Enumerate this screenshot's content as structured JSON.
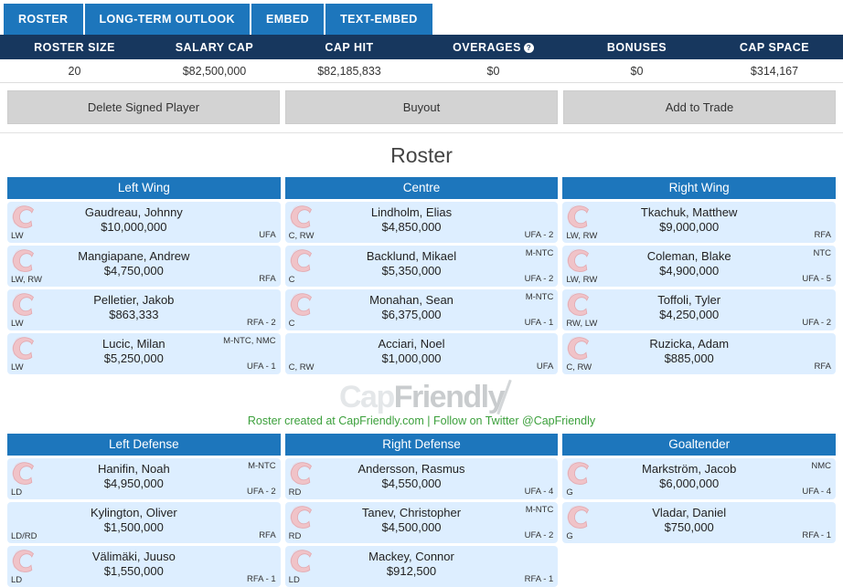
{
  "tabs": [
    {
      "label": "ROSTER",
      "active": true
    },
    {
      "label": "LONG-TERM OUTLOOK",
      "active": false
    },
    {
      "label": "EMBED",
      "active": false
    },
    {
      "label": "TEXT-EMBED",
      "active": false
    }
  ],
  "summary": {
    "headers": [
      "ROSTER SIZE",
      "SALARY CAP",
      "CAP HIT",
      "OVERAGES",
      "BONUSES",
      "CAP SPACE"
    ],
    "values": [
      "20",
      "$82,500,000",
      "$82,185,833",
      "$0",
      "$0",
      "$314,167"
    ],
    "overages_help_glyph": "?"
  },
  "actions": [
    {
      "label": "Delete Signed Player"
    },
    {
      "label": "Buyout"
    },
    {
      "label": "Add to Trade"
    }
  ],
  "roster_title": "Roster",
  "watermark": {
    "part1": "Cap",
    "part2": "Friendly"
  },
  "attribution": "Roster created at CapFriendly.com | Follow on Twitter @CapFriendly",
  "colors": {
    "tab_blue": "#1d76bc",
    "header_navy": "#17375e",
    "row_blue": "#ddeeff",
    "button_gray": "#d3d3d3",
    "attribution_green": "#3ca03c",
    "logo_pink": "#eebfc4"
  },
  "forwards": [
    {
      "heading": "Left Wing",
      "players": [
        {
          "name": "Gaudreau, Johnny",
          "salary": "$10,000,000",
          "pos": "LW",
          "clause": "",
          "expiry": "UFA",
          "logo": true
        },
        {
          "name": "Mangiapane, Andrew",
          "salary": "$4,750,000",
          "pos": "LW, RW",
          "clause": "",
          "expiry": "RFA",
          "logo": true
        },
        {
          "name": "Pelletier, Jakob",
          "salary": "$863,333",
          "pos": "LW",
          "clause": "",
          "expiry": "RFA - 2",
          "logo": true
        },
        {
          "name": "Lucic, Milan",
          "salary": "$5,250,000",
          "pos": "LW",
          "clause": "M-NTC, NMC",
          "expiry": "UFA - 1",
          "logo": true
        }
      ]
    },
    {
      "heading": "Centre",
      "players": [
        {
          "name": "Lindholm, Elias",
          "salary": "$4,850,000",
          "pos": "C, RW",
          "clause": "",
          "expiry": "UFA - 2",
          "logo": true
        },
        {
          "name": "Backlund, Mikael",
          "salary": "$5,350,000",
          "pos": "C",
          "clause": "M-NTC",
          "expiry": "UFA - 2",
          "logo": true
        },
        {
          "name": "Monahan, Sean",
          "salary": "$6,375,000",
          "pos": "C",
          "clause": "M-NTC",
          "expiry": "UFA - 1",
          "logo": true
        },
        {
          "name": "Acciari, Noel",
          "salary": "$1,000,000",
          "pos": "C, RW",
          "clause": "",
          "expiry": "UFA",
          "logo": false
        }
      ]
    },
    {
      "heading": "Right Wing",
      "players": [
        {
          "name": "Tkachuk, Matthew",
          "salary": "$9,000,000",
          "pos": "LW, RW",
          "clause": "",
          "expiry": "RFA",
          "logo": true
        },
        {
          "name": "Coleman, Blake",
          "salary": "$4,900,000",
          "pos": "LW, RW",
          "clause": "NTC",
          "expiry": "UFA - 5",
          "logo": true
        },
        {
          "name": "Toffoli, Tyler",
          "salary": "$4,250,000",
          "pos": "RW, LW",
          "clause": "",
          "expiry": "UFA - 2",
          "logo": true
        },
        {
          "name": "Ruzicka, Adam",
          "salary": "$885,000",
          "pos": "C, RW",
          "clause": "",
          "expiry": "RFA",
          "logo": true
        }
      ]
    }
  ],
  "defense": [
    {
      "heading": "Left Defense",
      "players": [
        {
          "name": "Hanifin, Noah",
          "salary": "$4,950,000",
          "pos": "LD",
          "clause": "M-NTC",
          "expiry": "UFA - 2",
          "logo": true
        },
        {
          "name": "Kylington, Oliver",
          "salary": "$1,500,000",
          "pos": "LD/RD",
          "clause": "",
          "expiry": "RFA",
          "logo": false
        },
        {
          "name": "Välimäki, Juuso",
          "salary": "$1,550,000",
          "pos": "LD",
          "clause": "",
          "expiry": "RFA - 1",
          "logo": true
        }
      ]
    },
    {
      "heading": "Right Defense",
      "players": [
        {
          "name": "Andersson, Rasmus",
          "salary": "$4,550,000",
          "pos": "RD",
          "clause": "",
          "expiry": "UFA - 4",
          "logo": true
        },
        {
          "name": "Tanev, Christopher",
          "salary": "$4,500,000",
          "pos": "RD",
          "clause": "M-NTC",
          "expiry": "UFA - 2",
          "logo": true
        },
        {
          "name": "Mackey, Connor",
          "salary": "$912,500",
          "pos": "LD",
          "clause": "",
          "expiry": "RFA - 1",
          "logo": true
        }
      ]
    },
    {
      "heading": "Goaltender",
      "players": [
        {
          "name": "Markström, Jacob",
          "salary": "$6,000,000",
          "pos": "G",
          "clause": "NMC",
          "expiry": "UFA - 4",
          "logo": true
        },
        {
          "name": "Vladar, Daniel",
          "salary": "$750,000",
          "pos": "G",
          "clause": "",
          "expiry": "RFA - 1",
          "logo": true
        }
      ]
    }
  ]
}
